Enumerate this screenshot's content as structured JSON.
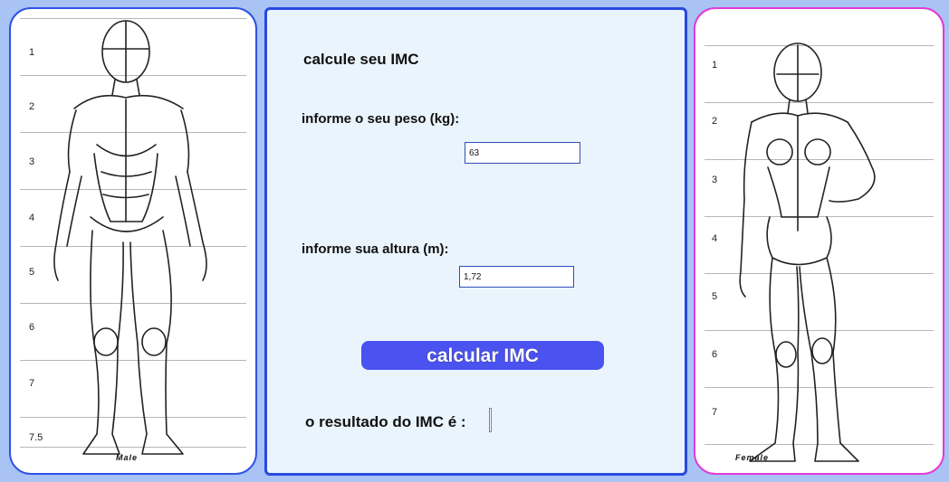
{
  "left_chart": {
    "scale_numbers": [
      "1",
      "2",
      "3",
      "4",
      "5",
      "6",
      "7",
      "7.5"
    ],
    "caption": "Male"
  },
  "right_chart": {
    "scale_numbers": [
      "1",
      "2",
      "3",
      "4",
      "5",
      "6",
      "7"
    ],
    "caption": "Female"
  },
  "form": {
    "title": "calcule seu IMC",
    "weight_label": "informe o seu peso (kg):",
    "weight_value": "63",
    "height_label": "informe sua altura (m):",
    "height_value": "1,72",
    "button_label": "calcular IMC",
    "result_label": "o resultado do IMC é :"
  },
  "colors": {
    "background": "#a8c3f4",
    "left_border": "#2f53e3",
    "right_border": "#e23ad6",
    "button": "#4a52f0"
  }
}
